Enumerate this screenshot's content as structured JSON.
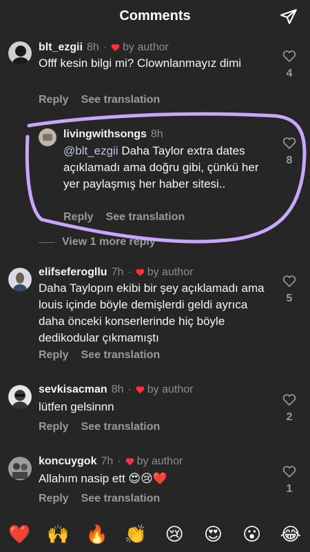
{
  "header": {
    "title": "Comments"
  },
  "comments": [
    {
      "user": "blt_ezgii",
      "time": "8h",
      "author": "by author",
      "text": "Offf kesin bilgi mi? Clownlanmayız dimi",
      "reply": "Reply",
      "translate": "See translation",
      "likes": "4"
    },
    {
      "user": "livingwithsongs",
      "time": "8h",
      "mention": "@blt_ezgii",
      "text": "Daha Taylor extra dates açıklamadı ama doğru gibi, çünkü her yer paylaşmış her haber sitesi..",
      "reply": "Reply",
      "translate": "See translation",
      "likes": "8"
    },
    {
      "user": "elifseferogllu",
      "time": "7h",
      "author": "by author",
      "text": "Daha Tayloрın ekibi bir şey açıklamadı ama louis içinde böyle demişlerdi geldi ayrıca daha önceki konserlerinde hiç böyle dedikodular çıkmamıştı",
      "reply": "Reply",
      "translate": "See translation",
      "likes": "5"
    },
    {
      "user": "sevkisacman",
      "time": "8h",
      "author": "by author",
      "text": "lütfen gelsinnn",
      "reply": "Reply",
      "translate": "See translation",
      "likes": "2"
    },
    {
      "user": "koncuygok",
      "time": "7h",
      "author": "by author",
      "text": "Allahım nasip ett 😍😢❤️",
      "reply": "Reply",
      "translate": "See translation",
      "likes": "1"
    }
  ],
  "view_more": "View 1 more reply",
  "emoji_bar": [
    "❤️",
    "🙌",
    "🔥",
    "👏",
    "😢",
    "😍",
    "😮",
    "😂"
  ],
  "colors": {
    "background": "#262626",
    "heart": "#ff3040",
    "scribble": "#c9a6ff"
  }
}
